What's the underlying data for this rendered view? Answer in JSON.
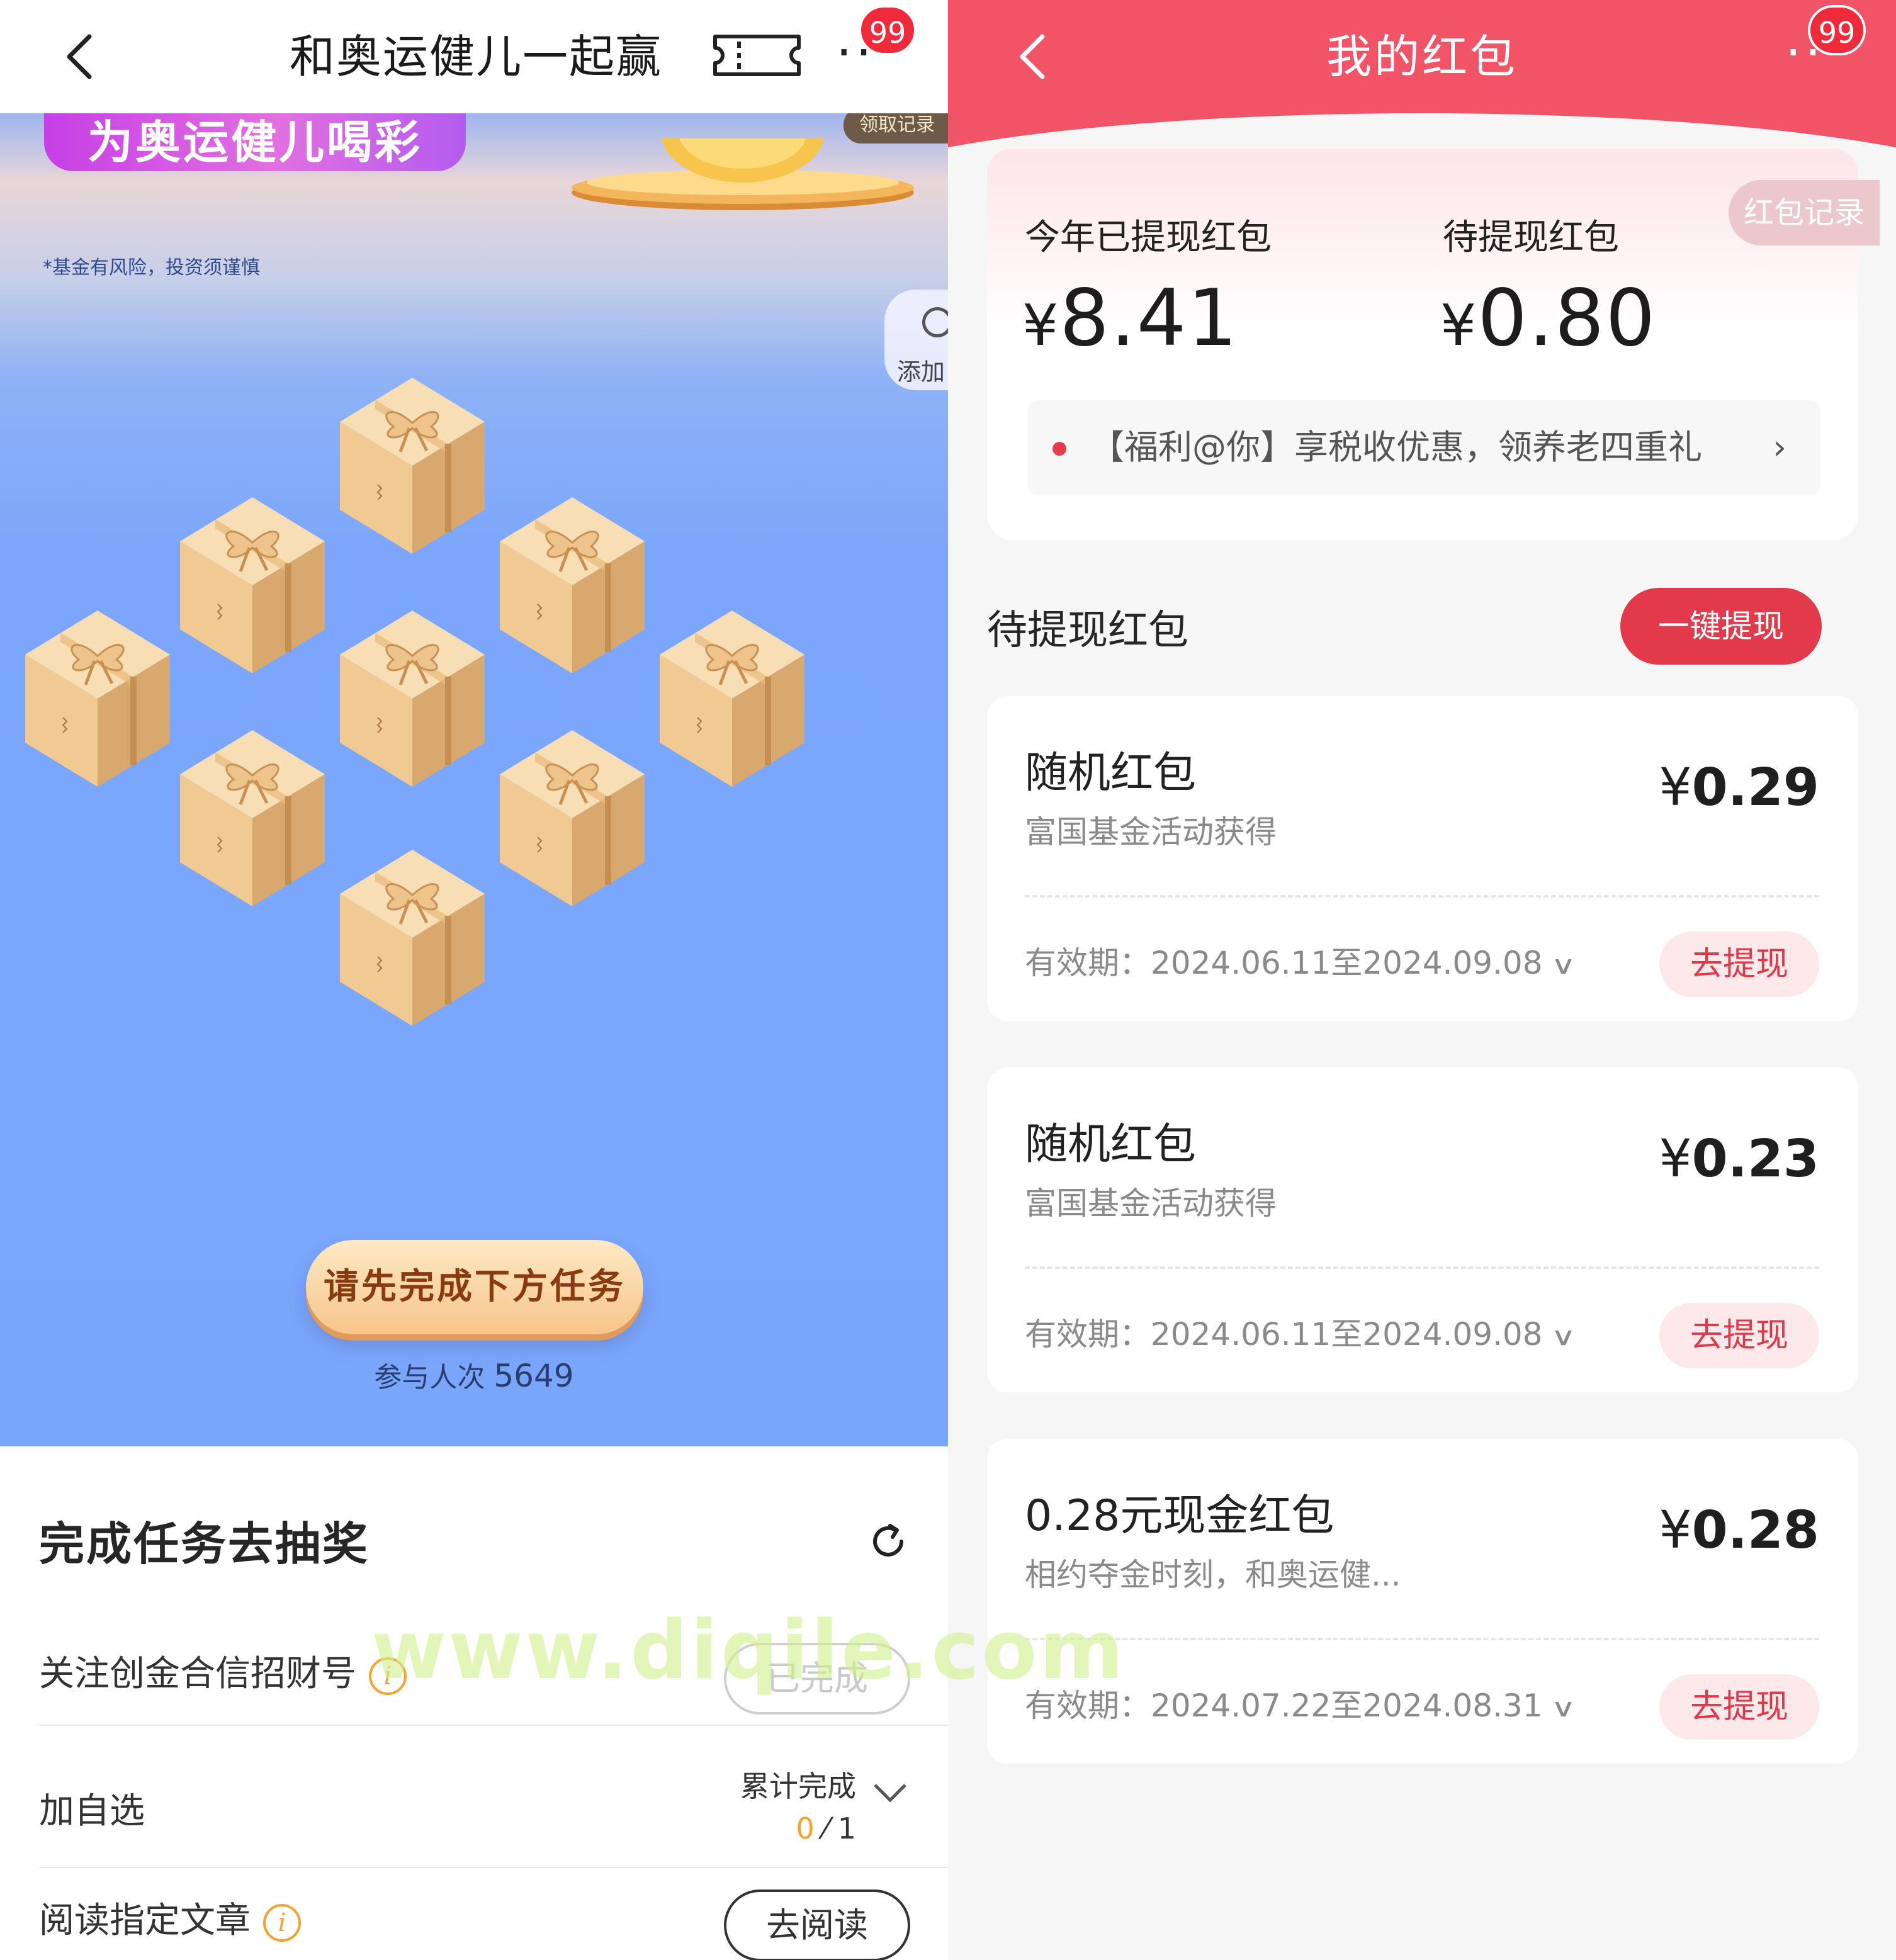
{
  "left": {
    "nav": {
      "title": "和奥运健儿一起赢",
      "more_badge": "99"
    },
    "hero": {
      "banner": "为奥运健儿喝彩",
      "claim_record": "领取记录",
      "risk_note": "*基金有风险，投资须谨慎",
      "add_label": "添加",
      "task_button": "请先完成下方任务",
      "participants_label": "参与人次",
      "participants_count": "5649"
    },
    "tasks": {
      "heading": "完成任务去抽奖",
      "items": [
        {
          "name": "关注创金合信招财号",
          "action": "已完成"
        },
        {
          "name": "加自选",
          "progress_label": "累计完成",
          "done": "0",
          "total": "1"
        },
        {
          "name": "阅读指定文章",
          "action": "去阅读"
        }
      ]
    },
    "watermark": "www.diqile.com"
  },
  "right": {
    "nav": {
      "title": "我的红包",
      "more_badge": "99"
    },
    "summary": {
      "withdrawn_label": "今年已提现红包",
      "withdrawn_amount": "8.41",
      "pending_label": "待提现红包",
      "pending_amount": "0.80",
      "currency": "¥",
      "record_button": "红包记录",
      "notice": "【福利@你】享税收优惠，领养老四重礼",
      "notice_arrow": "›"
    },
    "pending_section": {
      "heading": "待提现红包",
      "one_key_button": "一键提现",
      "valid_prefix": "有效期：",
      "withdraw_label": "去提现",
      "items": [
        {
          "name": "随机红包",
          "source": "富国基金活动获得",
          "amount": "0.29",
          "validity": "2024.06.11至2024.09.08"
        },
        {
          "name": "随机红包",
          "source": "富国基金活动获得",
          "amount": "0.23",
          "validity": "2024.06.11至2024.09.08"
        },
        {
          "name": "0.28元现金红包",
          "source": "相约夺金时刻，和奥运健...",
          "amount": "0.28",
          "validity": "2024.07.22至2024.08.31"
        }
      ]
    }
  },
  "colors": {
    "red_header": "#f05466",
    "red_button": "#e33a4b",
    "hero_blue": "#79a6fb",
    "gift_tan": "#f2cf9d",
    "task_orange": "#f3a332"
  }
}
